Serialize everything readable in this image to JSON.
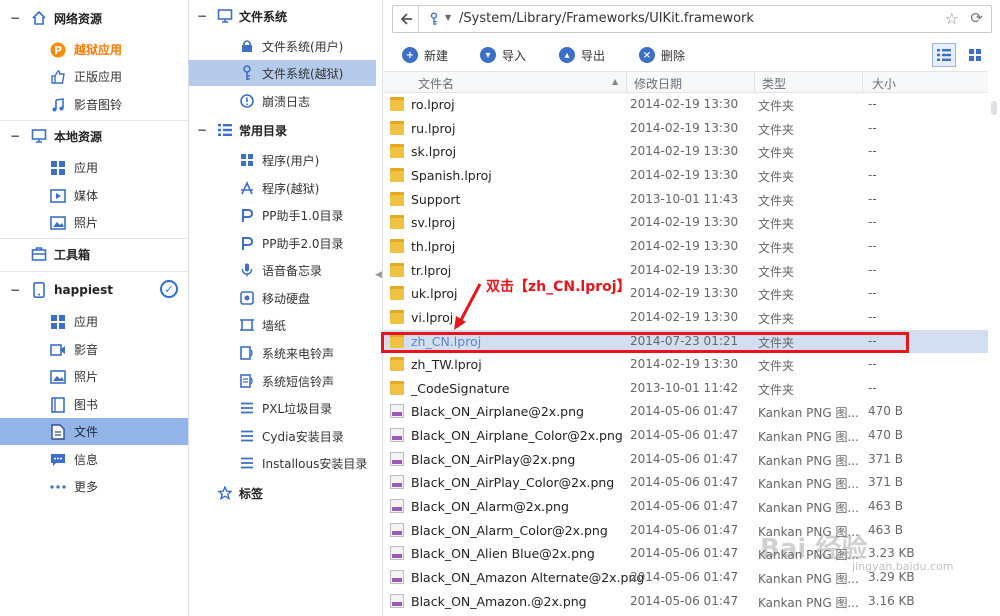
{
  "left_nav": {
    "network": {
      "label": "网络资源",
      "items": [
        {
          "label": "越狱应用"
        },
        {
          "label": "正版应用"
        },
        {
          "label": "影音图铃"
        }
      ]
    },
    "local": {
      "label": "本地资源",
      "items": [
        {
          "label": "应用"
        },
        {
          "label": "媒体"
        },
        {
          "label": "照片"
        }
      ]
    },
    "toolbox": {
      "label": "工具箱"
    },
    "device": {
      "label": "happiest",
      "items": [
        {
          "label": "应用"
        },
        {
          "label": "影音"
        },
        {
          "label": "照片"
        },
        {
          "label": "图书"
        },
        {
          "label": "文件"
        },
        {
          "label": "信息"
        },
        {
          "label": "更多"
        }
      ]
    }
  },
  "tree": {
    "fs": {
      "label": "文件系统",
      "items": [
        {
          "label": "文件系统(用户)"
        },
        {
          "label": "文件系统(越狱)"
        },
        {
          "label": "崩溃日志"
        }
      ]
    },
    "common": {
      "label": "常用目录",
      "items": [
        {
          "label": "程序(用户)"
        },
        {
          "label": "程序(越狱)"
        },
        {
          "label": "PP助手1.0目录"
        },
        {
          "label": "PP助手2.0目录"
        },
        {
          "label": "语音备忘录"
        },
        {
          "label": "移动硬盘"
        },
        {
          "label": "墙纸"
        },
        {
          "label": "系统来电铃声"
        },
        {
          "label": "系统短信铃声"
        },
        {
          "label": "PXL垃圾目录"
        },
        {
          "label": "Cydia安装目录"
        },
        {
          "label": "Installous安装目录"
        }
      ]
    },
    "tags": {
      "label": "标签"
    }
  },
  "address": {
    "path": "/System/Library/Frameworks/UIKit.framework"
  },
  "toolbar": {
    "new": "新建",
    "import": "导入",
    "export": "导出",
    "delete": "删除"
  },
  "columns": {
    "name": "文件名",
    "date": "修改日期",
    "type": "类型",
    "size": "大小"
  },
  "files": [
    {
      "name": "ro.lproj",
      "date": "2014-02-19 13:30",
      "type": "文件夹",
      "size": "--",
      "kind": "folder"
    },
    {
      "name": "ru.lproj",
      "date": "2014-02-19 13:30",
      "type": "文件夹",
      "size": "--",
      "kind": "folder"
    },
    {
      "name": "sk.lproj",
      "date": "2014-02-19 13:30",
      "type": "文件夹",
      "size": "--",
      "kind": "folder"
    },
    {
      "name": "Spanish.lproj",
      "date": "2014-02-19 13:30",
      "type": "文件夹",
      "size": "--",
      "kind": "folder"
    },
    {
      "name": "Support",
      "date": "2013-10-01 11:43",
      "type": "文件夹",
      "size": "--",
      "kind": "folder"
    },
    {
      "name": "sv.lproj",
      "date": "2014-02-19 13:30",
      "type": "文件夹",
      "size": "--",
      "kind": "folder"
    },
    {
      "name": "th.lproj",
      "date": "2014-02-19 13:30",
      "type": "文件夹",
      "size": "--",
      "kind": "folder"
    },
    {
      "name": "tr.lproj",
      "date": "2014-02-19 13:30",
      "type": "文件夹",
      "size": "--",
      "kind": "folder"
    },
    {
      "name": "uk.lproj",
      "date": "2014-02-19 13:30",
      "type": "文件夹",
      "size": "--",
      "kind": "folder"
    },
    {
      "name": "vi.lproj",
      "date": "2014-02-19 13:30",
      "type": "文件夹",
      "size": "--",
      "kind": "folder"
    },
    {
      "name": "zh_CN.lproj",
      "date": "2014-07-23 01:21",
      "type": "文件夹",
      "size": "--",
      "kind": "folder",
      "selected": true
    },
    {
      "name": "zh_TW.lproj",
      "date": "2014-02-19 13:30",
      "type": "文件夹",
      "size": "--",
      "kind": "folder"
    },
    {
      "name": "_CodeSignature",
      "date": "2013-10-01 11:42",
      "type": "文件夹",
      "size": "--",
      "kind": "folder"
    },
    {
      "name": "Black_ON_Airplane@2x.png",
      "date": "2014-05-06 01:47",
      "type": "Kankan PNG 图...",
      "size": "470 B",
      "kind": "png"
    },
    {
      "name": "Black_ON_Airplane_Color@2x.png",
      "date": "2014-05-06 01:47",
      "type": "Kankan PNG 图...",
      "size": "470 B",
      "kind": "png"
    },
    {
      "name": "Black_ON_AirPlay@2x.png",
      "date": "2014-05-06 01:47",
      "type": "Kankan PNG 图...",
      "size": "371 B",
      "kind": "png"
    },
    {
      "name": "Black_ON_AirPlay_Color@2x.png",
      "date": "2014-05-06 01:47",
      "type": "Kankan PNG 图...",
      "size": "371 B",
      "kind": "png"
    },
    {
      "name": "Black_ON_Alarm@2x.png",
      "date": "2014-05-06 01:47",
      "type": "Kankan PNG 图...",
      "size": "463 B",
      "kind": "png"
    },
    {
      "name": "Black_ON_Alarm_Color@2x.png",
      "date": "2014-05-06 01:47",
      "type": "Kankan PNG 图...",
      "size": "463 B",
      "kind": "png"
    },
    {
      "name": "Black_ON_Alien Blue@2x.png",
      "date": "2014-05-06 01:47",
      "type": "Kankan PNG 图...",
      "size": "3.23 KB",
      "kind": "png"
    },
    {
      "name": "Black_ON_Amazon Alternate@2x.png",
      "date": "2014-05-06 01:47",
      "type": "Kankan PNG 图...",
      "size": "3.29 KB",
      "kind": "png"
    },
    {
      "name": "Black_ON_Amazon.@2x.png",
      "date": "2014-05-06 01:47",
      "type": "Kankan PNG 图...",
      "size": "3.16 KB",
      "kind": "png"
    }
  ],
  "annotation": {
    "text": "双击【zh_CN.lproj】"
  },
  "watermark": {
    "brand": "Bai 经验",
    "url": "jingyan.baidu.com"
  },
  "colors": {
    "accent": "#3b6fc8",
    "hot": "#ff7a00",
    "highlight": "#e8141c",
    "selected_row": "#d3dff0"
  }
}
